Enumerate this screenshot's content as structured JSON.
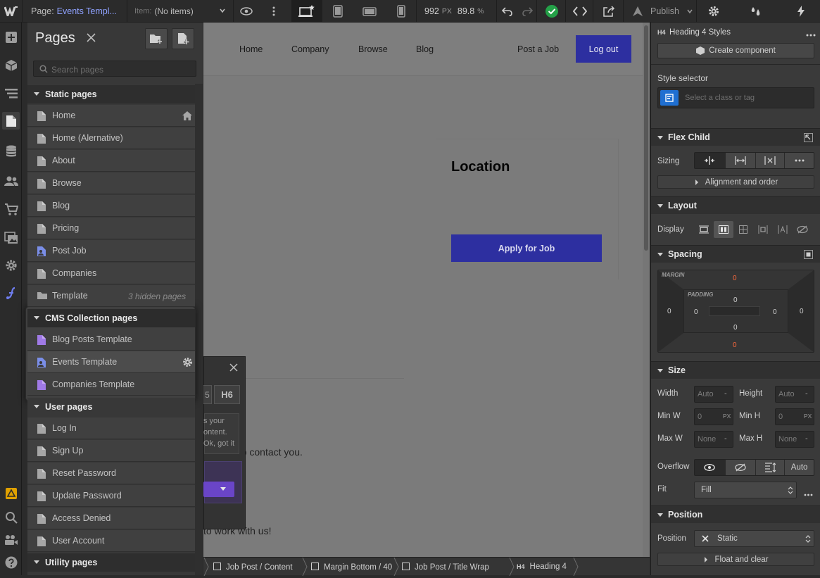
{
  "topbar": {
    "page_label": "Page:",
    "page_name": "Events Templ...",
    "item_label": "Item:",
    "item_value": "(No items)",
    "width_value": "992",
    "width_unit": "PX",
    "zoom_value": "89.8",
    "zoom_unit": "%",
    "publish_label": "Publish"
  },
  "pages_panel": {
    "title": "Pages",
    "search_placeholder": "Search pages",
    "static_header": "Static pages",
    "static_items": [
      "Home",
      "Home (Alernative)",
      "About",
      "Browse",
      "Blog",
      "Pricing",
      "Post Job",
      "Companies",
      "Template"
    ],
    "template_hidden": "3 hidden pages",
    "cms_header": "CMS Collection pages",
    "cms_items": [
      "Blog Posts Template",
      "Events Template",
      "Companies Template"
    ],
    "user_header": "User pages",
    "user_items": [
      "Log In",
      "Sign Up",
      "Reset Password",
      "Update Password",
      "Access Denied",
      "User Account"
    ],
    "utility_header": "Utility pages"
  },
  "canvas": {
    "nav": [
      "Home",
      "Company",
      "Browse",
      "Blog"
    ],
    "post_job": "Post a Job",
    "logout": "Log out",
    "heading": "Location",
    "apply_button": "Apply for Job",
    "body_text_1": "be able to contact you.",
    "body_text_2": "to work with us!",
    "popup_tab_h6": "H6",
    "popup_tab_prev": "5",
    "popup_text_1": "s your",
    "popup_text_2": "ontent.",
    "popup_text_3": "Ok, got it"
  },
  "right_panel": {
    "element_title": "Heading 4 Styles",
    "create_component": "Create component",
    "style_selector_label": "Style selector",
    "selector_placeholder": "Select a class or tag",
    "flex_child": "Flex Child",
    "sizing_label": "Sizing",
    "alignment_order": "Alignment and order",
    "layout": "Layout",
    "display_label": "Display",
    "spacing": "Spacing",
    "margin_label": "MARGIN",
    "padding_label": "PADDING",
    "margin_top": "0",
    "margin_bottom": "0",
    "margin_left": "0",
    "margin_right": "0",
    "padding_top": "0",
    "padding_bottom": "0",
    "padding_left": "0",
    "padding_right": "0",
    "size": "Size",
    "width_label": "Width",
    "width_val": "Auto",
    "height_label": "Height",
    "height_val": "Auto",
    "minw_label": "Min W",
    "minw_val": "0",
    "minw_unit": "PX",
    "minh_label": "Min H",
    "minh_val": "0",
    "minh_unit": "PX",
    "maxw_label": "Max W",
    "maxw_val": "None",
    "maxh_label": "Max H",
    "maxh_val": "None",
    "overflow_label": "Overflow",
    "overflow_auto": "Auto",
    "fit_label": "Fit",
    "fit_val": "Fill",
    "position": "Position",
    "position_label": "Position",
    "position_val": "Static",
    "float_clear": "Float and clear"
  },
  "breadcrumbs": [
    "Job Post / Content",
    "Margin Bottom / 40",
    "Job Post / Title Wrap",
    "Heading 4"
  ],
  "colors": {
    "accent_blue": "#2d2fa0",
    "check_green": "#24a148",
    "cms_purple": "#8a63d2",
    "warning_yellow": "#e0a100"
  }
}
